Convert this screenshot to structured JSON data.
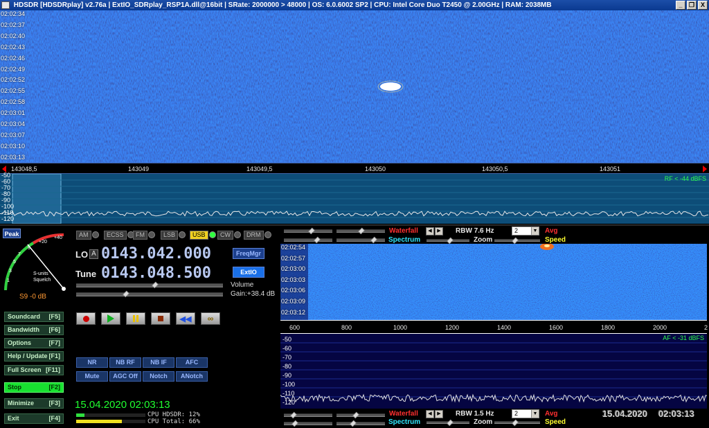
{
  "titlebar": {
    "text": "HDSDR  [HDSDRplay]  v2.76a  |  ExtIO_SDRplay_RSP1A.dll@16bit  |  SRate: 2000000 > 48000  |  OS: 6.0.6002 SP2  |  CPU: Intel Core Duo      T2450  @ 2.00GHz  |  RAM: 2038MB",
    "minimize": "_",
    "restore": "❐",
    "close": "X"
  },
  "waterfall": {
    "times": [
      "02:02:34",
      "02:02:37",
      "02:02:40",
      "02:02:43",
      "02:02:46",
      "02:02:49",
      "02:02:52",
      "02:02:55",
      "02:02:58",
      "02:03:01",
      "02:03:04",
      "02:03:07",
      "02:03:10",
      "02:03:13"
    ]
  },
  "freq_axis": {
    "ticks": [
      "143048,5",
      "143049",
      "143049,5",
      "143050",
      "143050,5",
      "143051"
    ]
  },
  "spectrum": {
    "db_labels": [
      "-50",
      "-60",
      "-70",
      "-80",
      "-90",
      "-100",
      "-110",
      "-120"
    ],
    "rf_level": "RF < -44 dBFS"
  },
  "smeter": {
    "peak_label": "Peak",
    "scale": [
      "1",
      "3",
      "5",
      "7",
      "9",
      "+20",
      "+40"
    ],
    "unit_label": "S-units",
    "squelch_label": "Squelch",
    "reading": "S9 -0 dB"
  },
  "side_buttons": [
    {
      "label": "Soundcard",
      "key": "[F5]"
    },
    {
      "label": "Bandwidth",
      "key": "[F6]"
    },
    {
      "label": "Options",
      "key": "[F7]"
    },
    {
      "label": "Help / Update",
      "key": "[F1]"
    },
    {
      "label": "Full Screen",
      "key": "[F11]"
    },
    {
      "label": "Stop",
      "key": "[F2]"
    },
    {
      "label": "Minimize",
      "key": "[F3]"
    },
    {
      "label": "Exit",
      "key": "[F4]"
    }
  ],
  "modes": [
    "AM",
    "ECSS",
    "FM",
    "LSB",
    "USB",
    "CW",
    "DRM"
  ],
  "active_mode": "USB",
  "lo": {
    "label": "LO",
    "tag": "A",
    "value": "0143.042.000"
  },
  "tune": {
    "label": "Tune",
    "value": "0143.048.500"
  },
  "freqmgr_label": "FreqMgr",
  "extio_label": "ExtIO",
  "volume_label": "Volume",
  "gain_label": "Gain:+38.4 dB",
  "dsp_buttons": [
    [
      "NR",
      "NB RF",
      "NB IF",
      "AFC"
    ],
    [
      "Mute",
      "AGC Off",
      "Notch",
      "ANotch"
    ]
  ],
  "clock": "15.04.2020 02:03:13",
  "cpu": {
    "hdsdr": "CPU HDSDR: 12%",
    "total": "CPU Total: 66%",
    "hdsdr_frac": 0.12,
    "total_frac": 0.66
  },
  "right_top": {
    "waterfall": "Waterfall",
    "spectrum": "Spectrum",
    "rbw": "RBW  7.6 Hz",
    "zoom": "Zoom",
    "avg_value": "2",
    "avg": "Avg",
    "speed": "Speed"
  },
  "af_waterfall": {
    "times": [
      "02:02:54",
      "02:02:57",
      "02:03:00",
      "02:03:03",
      "02:03:06",
      "02:03:09",
      "02:03:12"
    ]
  },
  "af_axis": {
    "ticks": [
      "600",
      "800",
      "1000",
      "1200",
      "1400",
      "1600",
      "1800",
      "2000",
      "2"
    ]
  },
  "af_spectrum": {
    "db_labels": [
      "-50",
      "-60",
      "-70",
      "-80",
      "-90",
      "-100",
      "-110",
      "-120"
    ],
    "af_level": "AF < -31 dBFS"
  },
  "right_bottom": {
    "waterfall": "Waterfall",
    "spectrum": "Spectrum",
    "rbw": "RBW  1.5 Hz",
    "zoom": "Zoom",
    "avg_value": "2",
    "avg": "Avg",
    "speed": "Speed"
  },
  "bottom_clock": {
    "date": "15.04.2020",
    "time": "02:03:13"
  },
  "colors": {
    "waterfall_bg": "#102878",
    "stop_active": "#18e030",
    "clock": "#20ff30",
    "accent_red": "#ff3030"
  }
}
